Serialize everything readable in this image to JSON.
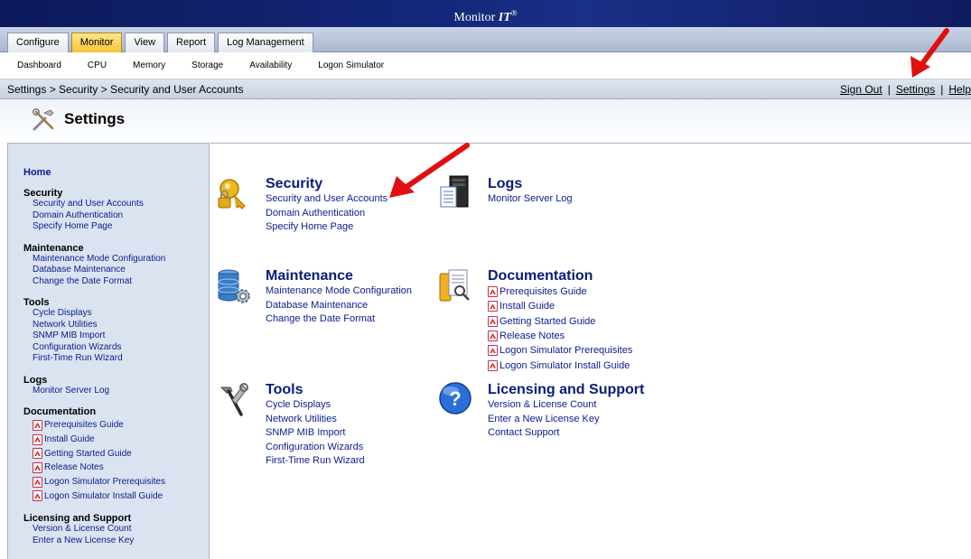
{
  "app": {
    "title_prefix": "Monitor ",
    "title_it": "IT",
    "title_reg": "®"
  },
  "tabs": [
    {
      "label": "Configure"
    },
    {
      "label": "Monitor"
    },
    {
      "label": "View"
    },
    {
      "label": "Report"
    },
    {
      "label": "Log Management"
    }
  ],
  "subnav": [
    "Dashboard",
    "CPU",
    "Memory",
    "Storage",
    "Availability",
    "Logon Simulator"
  ],
  "breadcrumb": "Settings > Security > Security and User Accounts",
  "toplinks": {
    "signout": "Sign Out",
    "settings": "Settings",
    "help": "Help",
    "sep": "|"
  },
  "page_title": "Settings",
  "sidebar": {
    "home": "Home",
    "security": {
      "title": "Security",
      "items": [
        "Security and User Accounts",
        "Domain Authentication",
        "Specify Home Page"
      ]
    },
    "maintenance": {
      "title": "Maintenance",
      "items": [
        "Maintenance Mode Configuration",
        "Database Maintenance",
        "Change the Date Format"
      ]
    },
    "tools": {
      "title": "Tools",
      "items": [
        "Cycle Displays",
        "Network Utilities",
        "SNMP MIB Import",
        "Configuration Wizards",
        "First-Time Run Wizard"
      ]
    },
    "logs": {
      "title": "Logs",
      "items": [
        "Monitor Server Log"
      ]
    },
    "documentation": {
      "title": "Documentation",
      "items": [
        "Prerequisites Guide",
        "Install Guide",
        "Getting Started Guide",
        "Release Notes",
        "Logon Simulator Prerequisites",
        "Logon Simulator Install Guide"
      ]
    },
    "licensing": {
      "title": "Licensing and Support",
      "items": [
        "Version & License Count",
        "Enter a New License Key"
      ]
    }
  },
  "main": {
    "security": {
      "title": "Security",
      "items": [
        "Security and User Accounts",
        "Domain Authentication",
        "Specify Home Page"
      ]
    },
    "logs": {
      "title": "Logs",
      "items": [
        "Monitor Server Log"
      ]
    },
    "maintenance": {
      "title": "Maintenance",
      "items": [
        "Maintenance Mode Configuration",
        "Database Maintenance",
        "Change the Date Format"
      ]
    },
    "documentation": {
      "title": "Documentation",
      "items": [
        "Prerequisites Guide",
        "Install Guide",
        "Getting Started Guide",
        "Release Notes",
        "Logon Simulator Prerequisites",
        "Logon Simulator Install Guide"
      ]
    },
    "tools": {
      "title": "Tools",
      "items": [
        "Cycle Displays",
        "Network Utilities",
        "SNMP MIB Import",
        "Configuration Wizards",
        "First-Time Run Wizard"
      ]
    },
    "licensing": {
      "title": "Licensing and Support",
      "items": [
        "Version & License Count",
        "Enter a New License Key",
        "Contact Support"
      ]
    }
  },
  "colors": {
    "link": "#0a1c8e",
    "active_tab": "#f4c43a",
    "annotation_arrow": "#e01010"
  }
}
